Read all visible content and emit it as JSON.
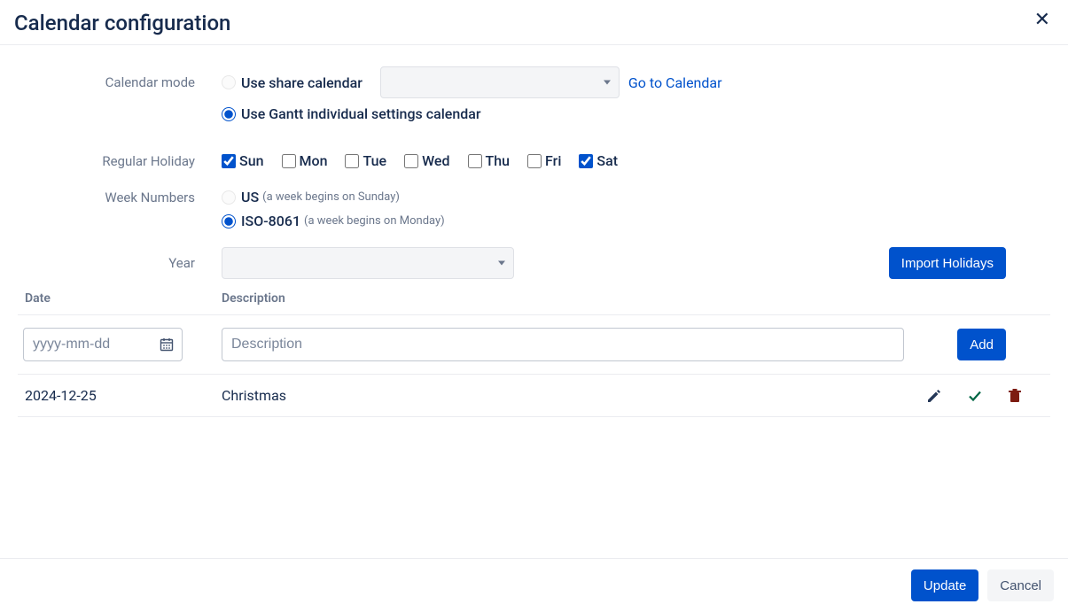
{
  "dialog": {
    "title": "Calendar configuration"
  },
  "labels": {
    "calendar_mode": "Calendar mode",
    "regular_holiday": "Regular Holiday",
    "week_numbers": "Week Numbers",
    "year": "Year",
    "date_col": "Date",
    "desc_col": "Description"
  },
  "calendar_mode": {
    "share_label": "Use share calendar",
    "individual_label": "Use Gantt individual settings calendar",
    "go_link": "Go to Calendar",
    "selected": "individual"
  },
  "days": {
    "sun": "Sun",
    "mon": "Mon",
    "tue": "Tue",
    "wed": "Wed",
    "thu": "Thu",
    "fri": "Fri",
    "sat": "Sat",
    "checked": {
      "sun": true,
      "mon": false,
      "tue": false,
      "wed": false,
      "thu": false,
      "fri": false,
      "sat": true
    }
  },
  "week_numbers": {
    "us_label": "US",
    "us_hint": "(a week begins on Sunday)",
    "iso_label": "ISO-8061",
    "iso_hint": "(a week begins on Monday)",
    "selected": "iso"
  },
  "buttons": {
    "import": "Import Holidays",
    "add": "Add",
    "update": "Update",
    "cancel": "Cancel"
  },
  "inputs": {
    "date_placeholder": "yyyy-mm-dd",
    "desc_placeholder": "Description"
  },
  "holidays": [
    {
      "date": "2024-12-25",
      "description": "Christmas"
    }
  ]
}
